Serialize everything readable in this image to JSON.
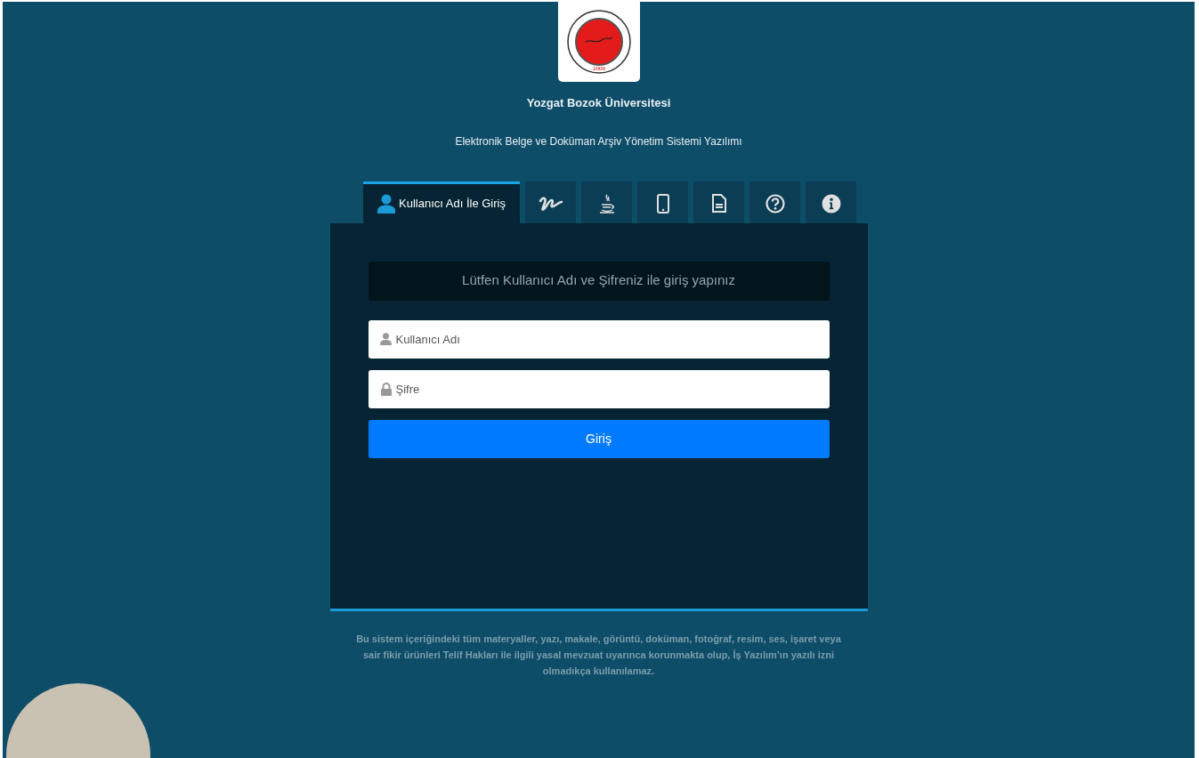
{
  "header": {
    "title": "Yozgat Bozok Üniversitesi",
    "subtitle": "Elektronik Belge ve Doküman Arşiv Yönetim Sistemi Yazılımı",
    "logo": {
      "year": "2006"
    }
  },
  "tabs": [
    {
      "kind": "user",
      "label": "Kullanıcı Adı İle Giriş",
      "selected": true
    },
    {
      "kind": "signature",
      "selected": false
    },
    {
      "kind": "java",
      "selected": false
    },
    {
      "kind": "mobile",
      "selected": false
    },
    {
      "kind": "document",
      "selected": false
    },
    {
      "kind": "help",
      "selected": false
    },
    {
      "kind": "info",
      "selected": false
    }
  ],
  "login": {
    "notice": "Lütfen Kullanıcı Adı ve Şifreniz ile giriş yapınız",
    "fields": [
      {
        "kind": "user",
        "placeholder": "Kullanıcı Adı"
      },
      {
        "kind": "password",
        "placeholder": "Şifre"
      }
    ],
    "button": "Giriş"
  },
  "footer": "Bu sistem içeriğindeki tüm materyaller, yazı, makale, görüntü, doküman, fotoğraf, resim, ses, işaret veya sair fikir ürünleri Telif Hakları ile ilgili yasal mevzuat uyarınca korunmakta olup, İş Yazılım’ın yazılı izni olmadıkça kullanılamaz."
}
